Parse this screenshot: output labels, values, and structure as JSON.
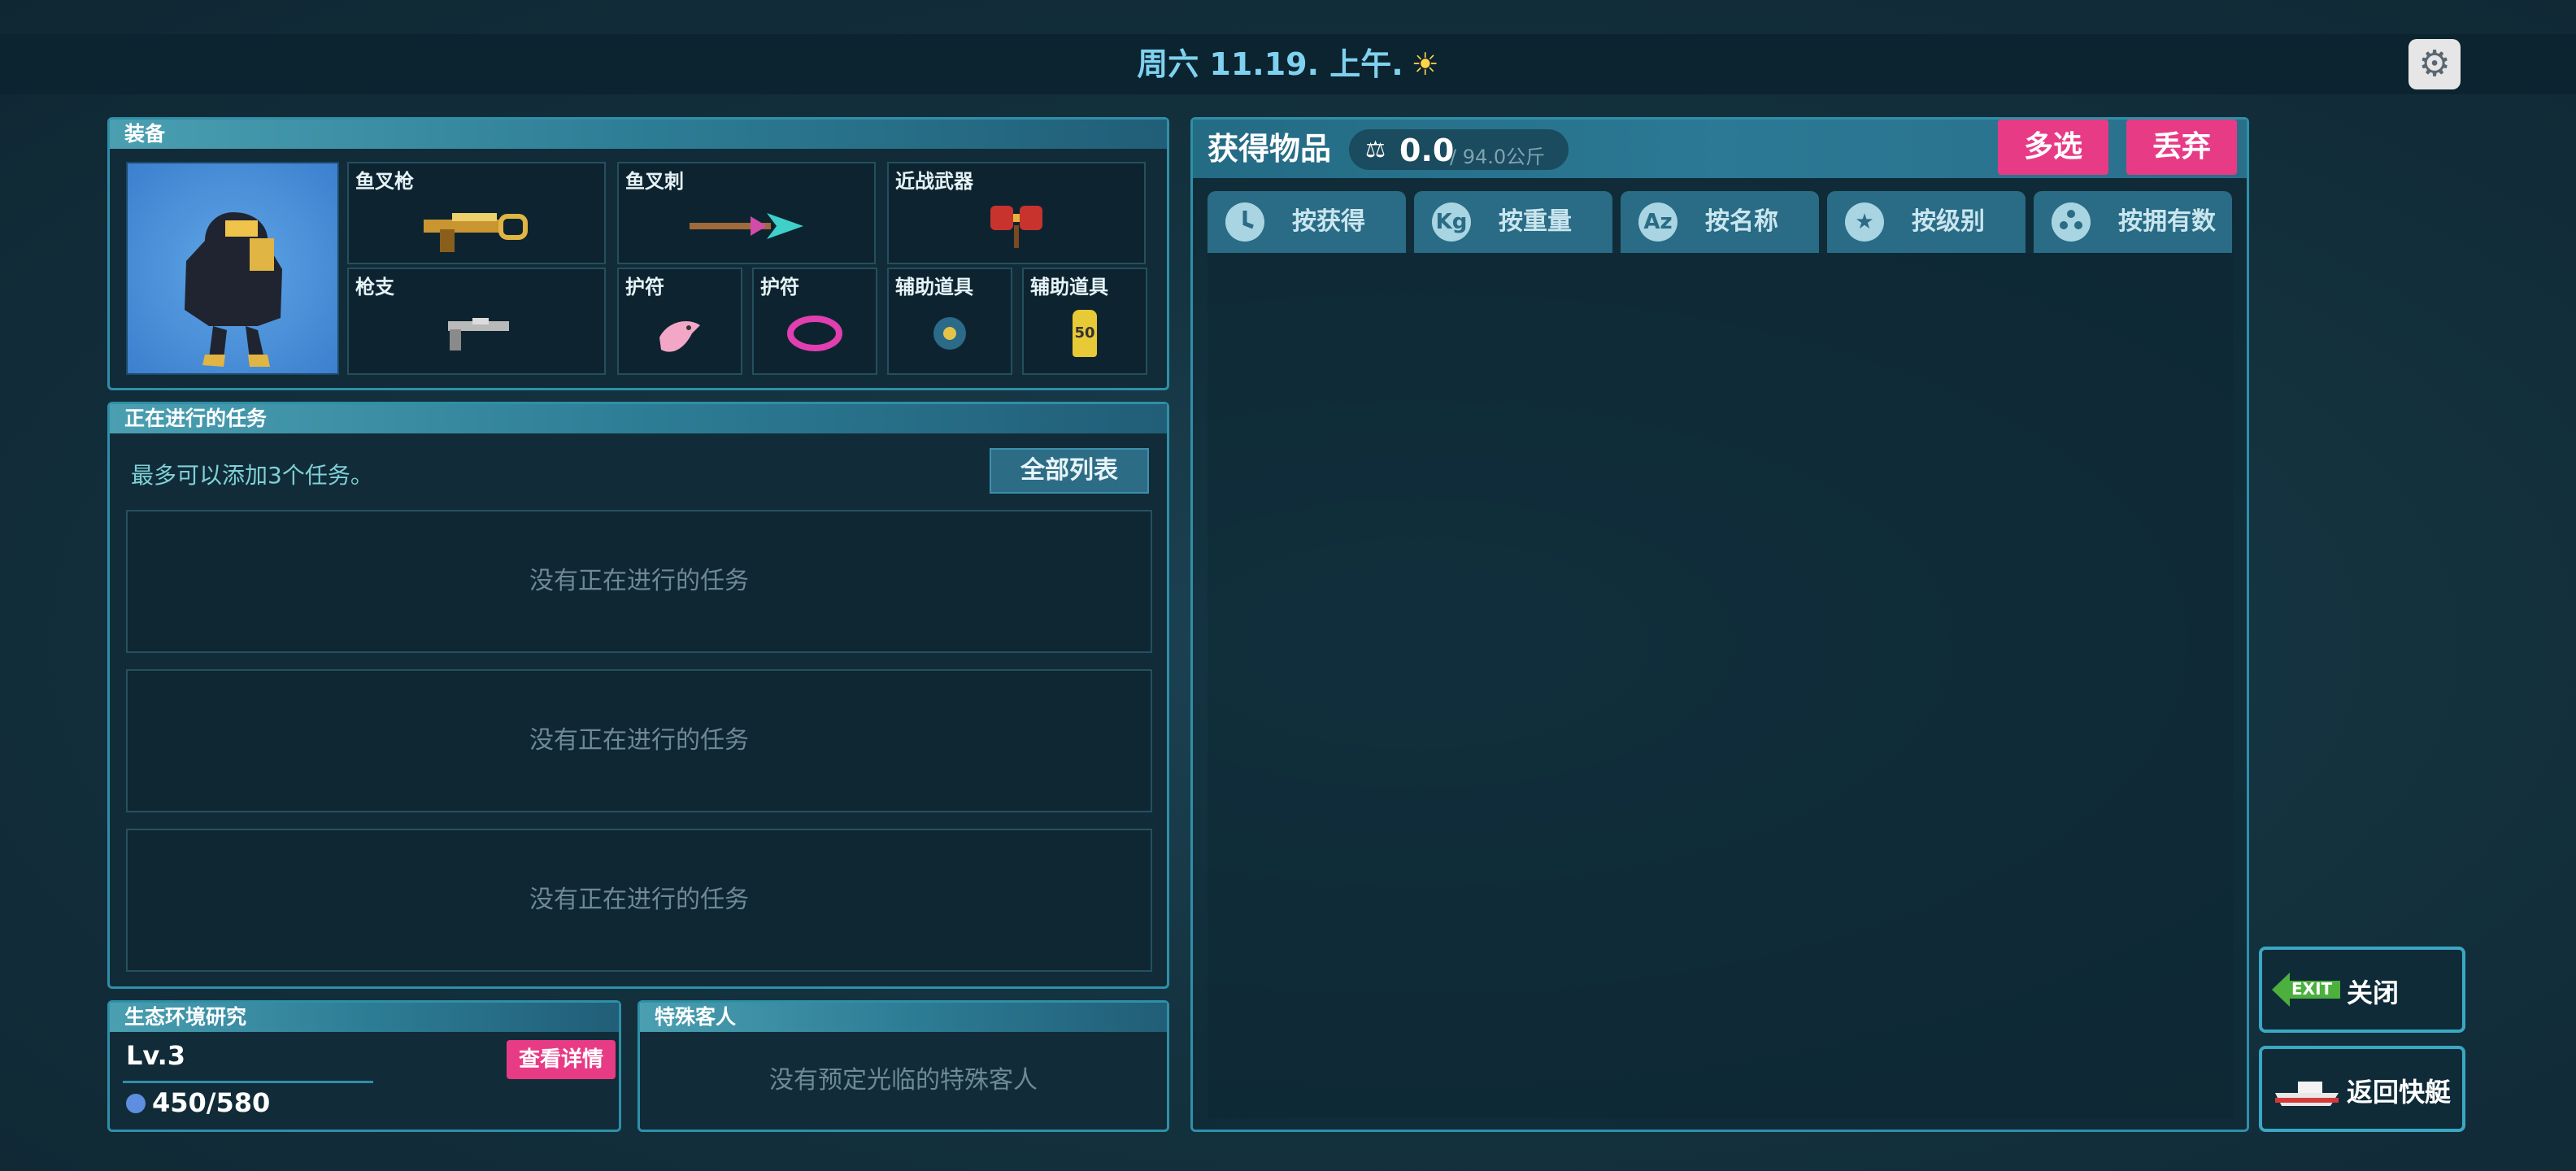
{
  "header": {
    "date": "周六 11.19. 上午.",
    "weather_icon": "sun-icon",
    "settings_icon": "gear-icon"
  },
  "equipment": {
    "title": "装备",
    "slots": [
      {
        "label": "鱼叉枪",
        "icon": "harpoon-gun-icon"
      },
      {
        "label": "鱼叉刺",
        "icon": "harpoon-spear-icon"
      },
      {
        "label": "近战武器",
        "icon": "melee-weapon-icon"
      },
      {
        "label": "枪支",
        "icon": "gun-icon"
      },
      {
        "label": "护符",
        "icon": "dolphin-charm-icon"
      },
      {
        "label": "护符",
        "icon": "bracelet-charm-icon"
      },
      {
        "label": "辅助道具",
        "icon": "mine-tool-icon"
      },
      {
        "label": "辅助道具",
        "icon": "oxygen-tank-icon"
      }
    ],
    "tank_label": "50"
  },
  "quests": {
    "title": "正在进行的任务",
    "hint": "最多可以添加3个任务。",
    "all_list_button": "全部列表",
    "entries": [
      "没有正在进行的任务",
      "没有正在进行的任务",
      "没有正在进行的任务"
    ]
  },
  "ecology": {
    "title": "生态环境研究",
    "level": "Lv.3",
    "details_button": "查看详情",
    "points": "450/580"
  },
  "special_guest": {
    "title": "特殊客人",
    "empty_text": "没有预定光临的特殊客人"
  },
  "inventory": {
    "title": "获得物品",
    "weight_value": "0.0",
    "weight_max": "/ 94.0公斤",
    "multi_select_button": "多选",
    "discard_button": "丢弃",
    "sort_tabs": [
      {
        "label": "按获得",
        "icon": "clock-icon",
        "glyph": ""
      },
      {
        "label": "按重量",
        "icon": "kg-icon",
        "glyph": "Kg"
      },
      {
        "label": "按名称",
        "icon": "az-icon",
        "glyph": "Az"
      },
      {
        "label": "按级别",
        "icon": "star-icon",
        "glyph": "★"
      },
      {
        "label": "按拥有数",
        "icon": "dots-icon",
        "glyph": ""
      }
    ]
  },
  "actions": {
    "exit_badge": "EXIT",
    "close_button": "关闭",
    "return_boat_button": "返回快艇"
  },
  "colors": {
    "accent": "#2f8fa8",
    "pink": "#e83b86",
    "date_text": "#7fd2ef"
  }
}
